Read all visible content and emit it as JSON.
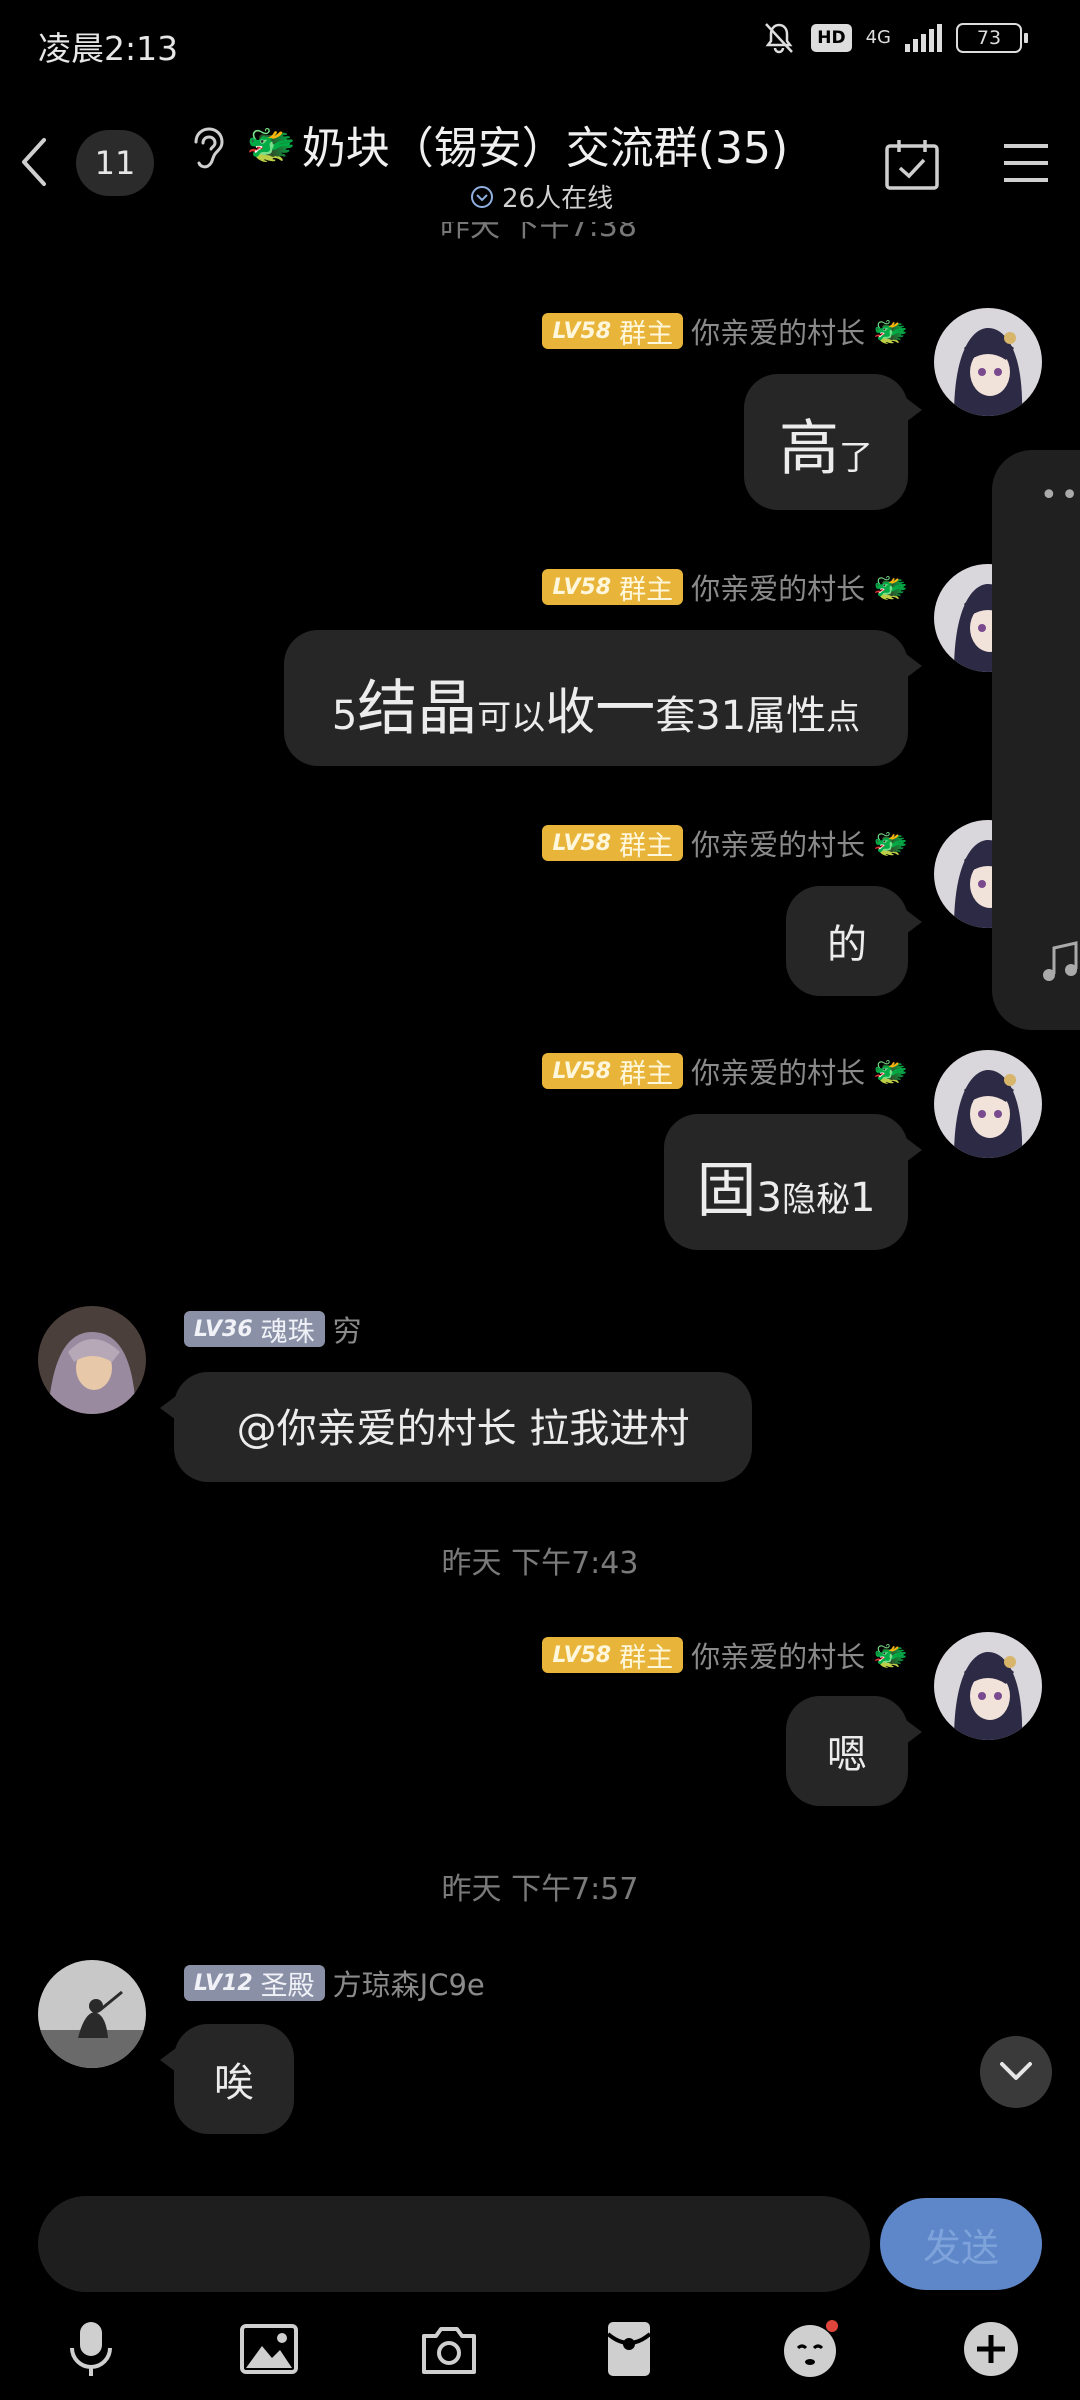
{
  "status_bar": {
    "time": "凌晨2:13",
    "network": "4G",
    "hd": "HD",
    "battery": "73"
  },
  "header": {
    "unread_count": "11",
    "group_name": "奶块（锡安）交流群(35)",
    "online_text": "26人在线",
    "partial_timestamp": "昨天 下午7:38"
  },
  "messages": [
    {
      "level": "LV58",
      "role": "群主",
      "nickname": "你亲爱的村长",
      "parts": [
        "高",
        "了"
      ]
    },
    {
      "level": "LV58",
      "role": "群主",
      "nickname": "你亲爱的村长",
      "parts": [
        "5",
        "结晶",
        "可以",
        "收",
        "一",
        "套",
        "31",
        "属性",
        "点"
      ]
    },
    {
      "level": "LV58",
      "role": "群主",
      "nickname": "你亲爱的村长",
      "parts": [
        "的"
      ]
    },
    {
      "level": "LV58",
      "role": "群主",
      "nickname": "你亲爱的村长",
      "parts": [
        "固",
        "3",
        "隐秘",
        "1"
      ]
    },
    {
      "level": "LV36",
      "role": "魂珠",
      "nickname": "穷",
      "text": "@你亲爱的村长 拉我进村"
    },
    {
      "timestamp": "昨天 下午7:43"
    },
    {
      "level": "LV58",
      "role": "群主",
      "nickname": "你亲爱的村长",
      "text": "嗯"
    },
    {
      "timestamp": "昨天 下午7:57"
    },
    {
      "level": "LV12",
      "role": "圣殿",
      "nickname": "方琼森JC9e",
      "text": "唉"
    }
  ],
  "timestamps": [
    "昨天 下午7:43",
    "昨天 下午7:57"
  ],
  "input": {
    "placeholder": "",
    "send_label": "发送"
  },
  "toolbar": [
    "mic-icon",
    "image-icon",
    "camera-icon",
    "red-packet-icon",
    "emoji-icon",
    "plus-icon"
  ],
  "colors": {
    "owner_badge": "#e8b53a",
    "grey_badge": "#8a90a6",
    "bubble": "#262626",
    "send": "#5e87c9",
    "background": "#000000"
  }
}
